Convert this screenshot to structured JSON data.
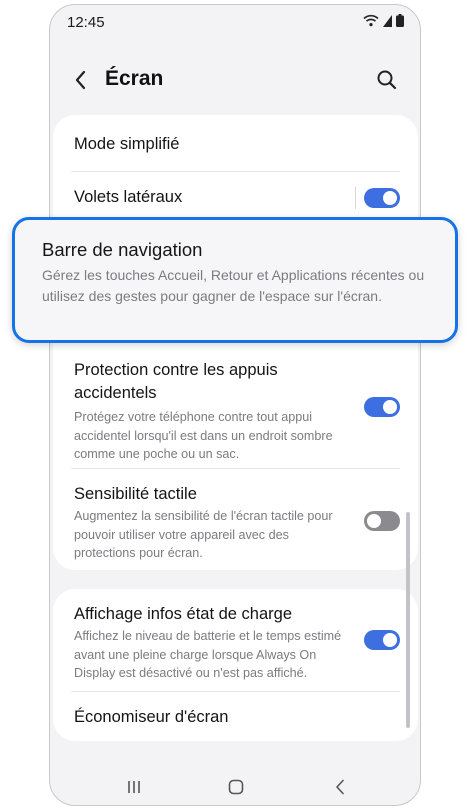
{
  "status_bar": {
    "time": "12:45",
    "icons": [
      "wifi-icon",
      "signal-icon",
      "battery-icon"
    ]
  },
  "header": {
    "title": "Écran",
    "back_icon": "chevron-left-icon",
    "search_icon": "search-icon"
  },
  "settings": {
    "mode_simplifie": {
      "title": "Mode simplifié"
    },
    "volets_lateraux": {
      "title": "Volets latéraux",
      "enabled": true
    },
    "protection": {
      "title": "Protection contre les appuis accidentels",
      "subtitle": "Protégez votre téléphone contre tout appui accidentel lorsqu'il est dans un endroit sombre comme une poche ou un sac.",
      "enabled": true
    },
    "sensibilite": {
      "title": "Sensibilité tactile",
      "subtitle": "Augmentez la sensibilité de l'écran tactile pour pouvoir utiliser votre appareil avec des protections pour écran.",
      "enabled": false
    },
    "affichage_charge": {
      "title": "Affichage infos état de charge",
      "subtitle": "Affichez le niveau de batterie et le temps estimé avant une pleine charge lorsque Always On Display est désactivé ou n'est pas affiché.",
      "enabled": true
    },
    "economiseur": {
      "title": "Économiseur d'écran"
    }
  },
  "callout": {
    "title": "Barre de navigation",
    "description": "Gérez les touches Accueil, Retour et Applications récentes ou utilisez des gestes pour gagner de l'espace sur l'écran."
  },
  "nav_bar": {
    "buttons": [
      "recent-apps-icon",
      "home-icon",
      "back-icon"
    ]
  },
  "colors": {
    "accent": "#3e6fe0",
    "highlight_border": "#1473e6",
    "background": "#f3f3f6",
    "toggle_off": "#8a8a8f"
  }
}
